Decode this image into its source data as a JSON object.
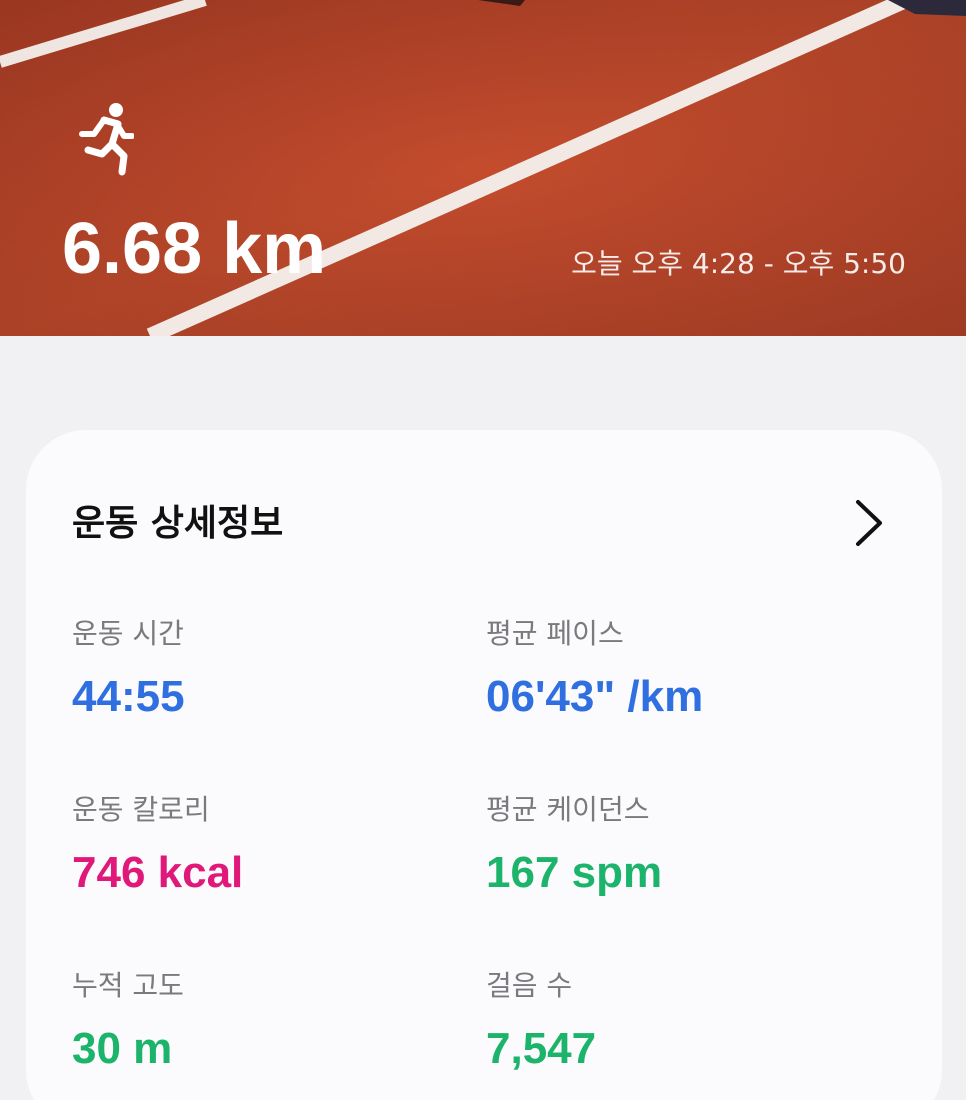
{
  "header": {
    "distance": "6.68 km",
    "time_range": "오늘 오후 4:28 - 오후 5:50",
    "activity_icon": "running-person-icon"
  },
  "details": {
    "title": "운동 상세정보",
    "chevron_icon": "chevron-right-icon",
    "metrics": [
      {
        "label": "운동 시간",
        "value": "44:55",
        "color": "#2f6fe0"
      },
      {
        "label": "평균 페이스",
        "value": "06'43\" /km",
        "color": "#2f6fe0"
      },
      {
        "label": "운동 칼로리",
        "value": "746 kcal",
        "color": "#e0187a"
      },
      {
        "label": "평균 케이던스",
        "value": "167 spm",
        "color": "#1cb36b"
      },
      {
        "label": "누적 고도",
        "value": "30 m",
        "color": "#1cb36b"
      },
      {
        "label": "걸음 수",
        "value": "7,547",
        "color": "#1cb36b"
      }
    ]
  },
  "colors": {
    "track": "#bb462b",
    "card_background": "#fbfbfd",
    "page_background": "#f1f1f3"
  }
}
